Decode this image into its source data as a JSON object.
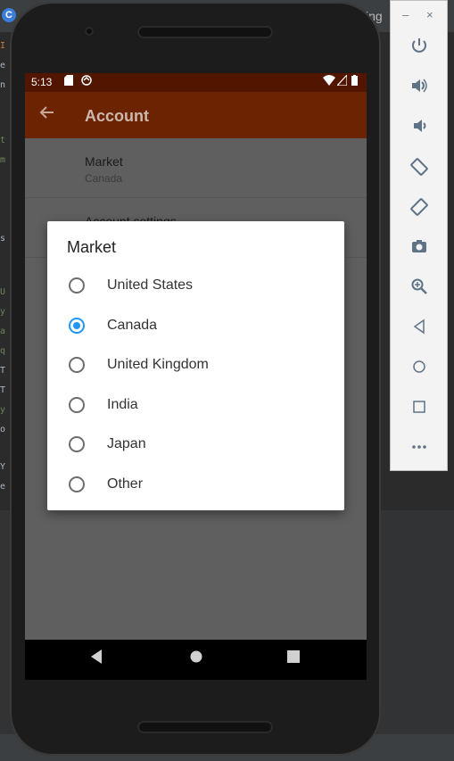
{
  "ide": {
    "logo": "C",
    "tab_fragment": "ing",
    "window_minimize": "–",
    "window_close": "×"
  },
  "emulator_toolbar": {
    "icons": [
      "power-icon",
      "volume-up-icon",
      "volume-down-icon",
      "rotate-left-icon",
      "rotate-right-icon",
      "camera-icon",
      "zoom-icon",
      "back-icon",
      "home-icon",
      "overview-icon",
      "more-icon"
    ]
  },
  "status_bar": {
    "time": "5:13"
  },
  "app_bar": {
    "title": "Account"
  },
  "preferences": [
    {
      "title": "Market",
      "summary": "Canada"
    },
    {
      "title": "Account settings",
      "summary": ""
    }
  ],
  "dialog": {
    "title": "Market",
    "options": [
      {
        "label": "United States",
        "checked": false
      },
      {
        "label": "Canada",
        "checked": true
      },
      {
        "label": "United Kingdom",
        "checked": false
      },
      {
        "label": "India",
        "checked": false
      },
      {
        "label": "Japan",
        "checked": false
      },
      {
        "label": "Other",
        "checked": false
      }
    ]
  },
  "colors": {
    "status_bar": "#521500",
    "app_bar": "#6c2301",
    "radio_accent": "#2196f3"
  }
}
